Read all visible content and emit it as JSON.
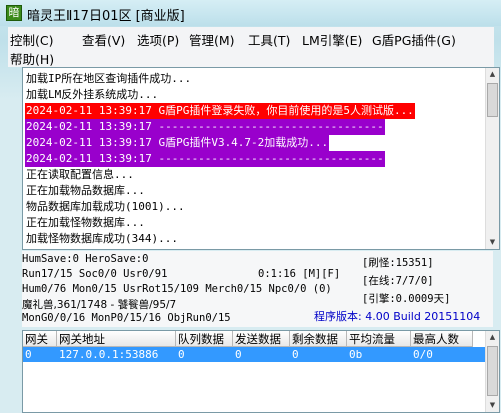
{
  "window": {
    "title": "暗灵王Ⅱ17日01区 [商业版]",
    "app_icon_glyph": "暗"
  },
  "menu": [
    {
      "label": "控制(C)"
    },
    {
      "label": "查看(V)"
    },
    {
      "label": "选项(P)"
    },
    {
      "label": "管理(M)"
    },
    {
      "label": "工具(T)"
    },
    {
      "label": "LM引擎(E)"
    },
    {
      "label": "G盾PG插件(G)"
    },
    {
      "label": "帮助(H)"
    }
  ],
  "log": {
    "lines": [
      {
        "text": "加载IP所在地区查询插件成功...",
        "bg": "",
        "color": "#000000"
      },
      {
        "text": "加载LM反外挂系统成功...",
        "bg": "",
        "color": "#000000"
      },
      {
        "text": "2024-02-11 13:39:17 G盾PG插件登录失败，你目前使用的是5人测试版...",
        "bg": "#ff0000",
        "color": "#ffffff"
      },
      {
        "text": "2024-02-11 13:39:17 ----------------------------------",
        "bg": "#9900cc",
        "color": "#ffffff"
      },
      {
        "text": "2024-02-11 13:39:17 G盾PG插件V3.4.7-2加载成功...",
        "bg": "#9900cc",
        "color": "#ffffff"
      },
      {
        "text": "2024-02-11 13:39:17 ----------------------------------",
        "bg": "#9900cc",
        "color": "#ffffff"
      },
      {
        "text": "正在读取配置信息...",
        "bg": "",
        "color": "#000000"
      },
      {
        "text": "正在加载物品数据库...",
        "bg": "",
        "color": "#000000"
      },
      {
        "text": "物品数据库加载成功(1001)...",
        "bg": "",
        "color": "#000000"
      },
      {
        "text": "正在加载怪物数据库...",
        "bg": "",
        "color": "#000000"
      },
      {
        "text": "加载怪物数据库成功(344)...",
        "bg": "",
        "color": "#000000"
      }
    ]
  },
  "status": {
    "line1": "HumSave:0 HeroSave:0",
    "line2": "Run17/15 Soc0/0 Usr0/91",
    "timer": "0:1:16 [M][F]",
    "line3": "Hum0/76 Mon0/15 UsrRot15/109 Merch0/15 Npc0/0 (0)",
    "line4": "魔礼兽,361/1748 - 饕餮兽/95/7",
    "line5": "MonG0/0/16 MonP0/15/16 ObjRun0/15",
    "refresh": "[刷怪:15351]",
    "online": "[在线:7/7/0]",
    "engine": "[引擎:0.0009天]",
    "version": "程序版本: 4.00 Build 20151104"
  },
  "table": {
    "headers": [
      "网关",
      "网关地址",
      "队列数据",
      "发送数据",
      "剩余数据",
      "平均流量",
      "最高人数"
    ],
    "rows": [
      [
        "0",
        "127.0.0.1:53886",
        "0",
        "0",
        "0",
        "0b",
        "0/0"
      ]
    ]
  }
}
